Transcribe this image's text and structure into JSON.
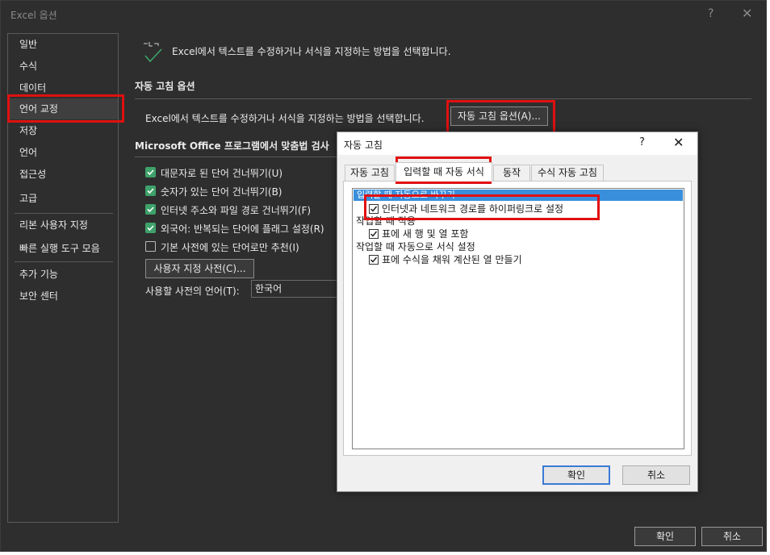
{
  "window": {
    "title": "Excel 옵션",
    "help": "?",
    "close": "✕"
  },
  "sidebar": {
    "items": [
      {
        "label": "일반"
      },
      {
        "label": "수식"
      },
      {
        "label": "데이터"
      },
      {
        "label": "언어 교정"
      },
      {
        "label": "저장"
      },
      {
        "label": "언어"
      },
      {
        "label": "접근성"
      },
      {
        "label": "고급"
      },
      {
        "label": "리본 사용자 지정"
      },
      {
        "label": "빠른 실행 도구 모음"
      },
      {
        "label": "추가 기능"
      },
      {
        "label": "보안 센터"
      }
    ],
    "selected": "언어 교정"
  },
  "main": {
    "header_text": "Excel에서 텍스트를 수정하거나 서식을 지정하는 방법을 선택합니다.",
    "autocorrect_section_title": "자동 고침 옵션",
    "autocorrect_desc": "Excel에서 텍스트를 수정하거나 서식을 지정하는 방법을 선택합니다.",
    "autocorrect_button": "자동 고침 옵션(A)...",
    "spelling_section_title": "Microsoft Office 프로그램에서 맞춤법 검사",
    "checkboxes": [
      {
        "label": "대문자로 된 단어 건너뛰기(U)",
        "checked": true
      },
      {
        "label": "숫자가 있는 단어 건너뛰기(B)",
        "checked": true
      },
      {
        "label": "인터넷 주소와 파일 경로 건너뛰기(F)",
        "checked": true
      },
      {
        "label": "외국어: 반복되는 단어에 플래그 설정(R)",
        "checked": true
      },
      {
        "label": "기본 사전에 있는 단어로만 추천(I)",
        "checked": false
      }
    ],
    "custom_dict_button": "사용자 지정 사전(C)...",
    "dict_lang_label": "사용할 사전의 언어(T):",
    "dict_lang_value": "한국어",
    "ok_button": "확인",
    "cancel_button": "취소"
  },
  "dialog": {
    "title": "자동 고침",
    "help": "?",
    "close": "✕",
    "tabs": [
      {
        "label": "자동 고침"
      },
      {
        "label": "입력할 때 자동 서식"
      },
      {
        "label": "동작"
      },
      {
        "label": "수식 자동 고침"
      }
    ],
    "active_tab": "입력할 때 자동 서식",
    "group1_label": "입력할 때 자동으로 바꾸기",
    "opt_hyperlink": "인터넷과 네트워크 경로를 하이퍼링크로 설정",
    "group2_label": "작업할 때 적용",
    "opt_new_rows": "표에 새 행 및 열 포함",
    "group3_label": "작업할 때 자동으로 서식 설정",
    "opt_fill_formulas": "표에 수식을 채워 계산된 열 만들기",
    "ok_button": "확인",
    "cancel_button": "취소"
  },
  "colors": {
    "highlight_red": "#e01010",
    "check_green": "#3ea26a",
    "selection_blue": "#3a8fdc"
  }
}
